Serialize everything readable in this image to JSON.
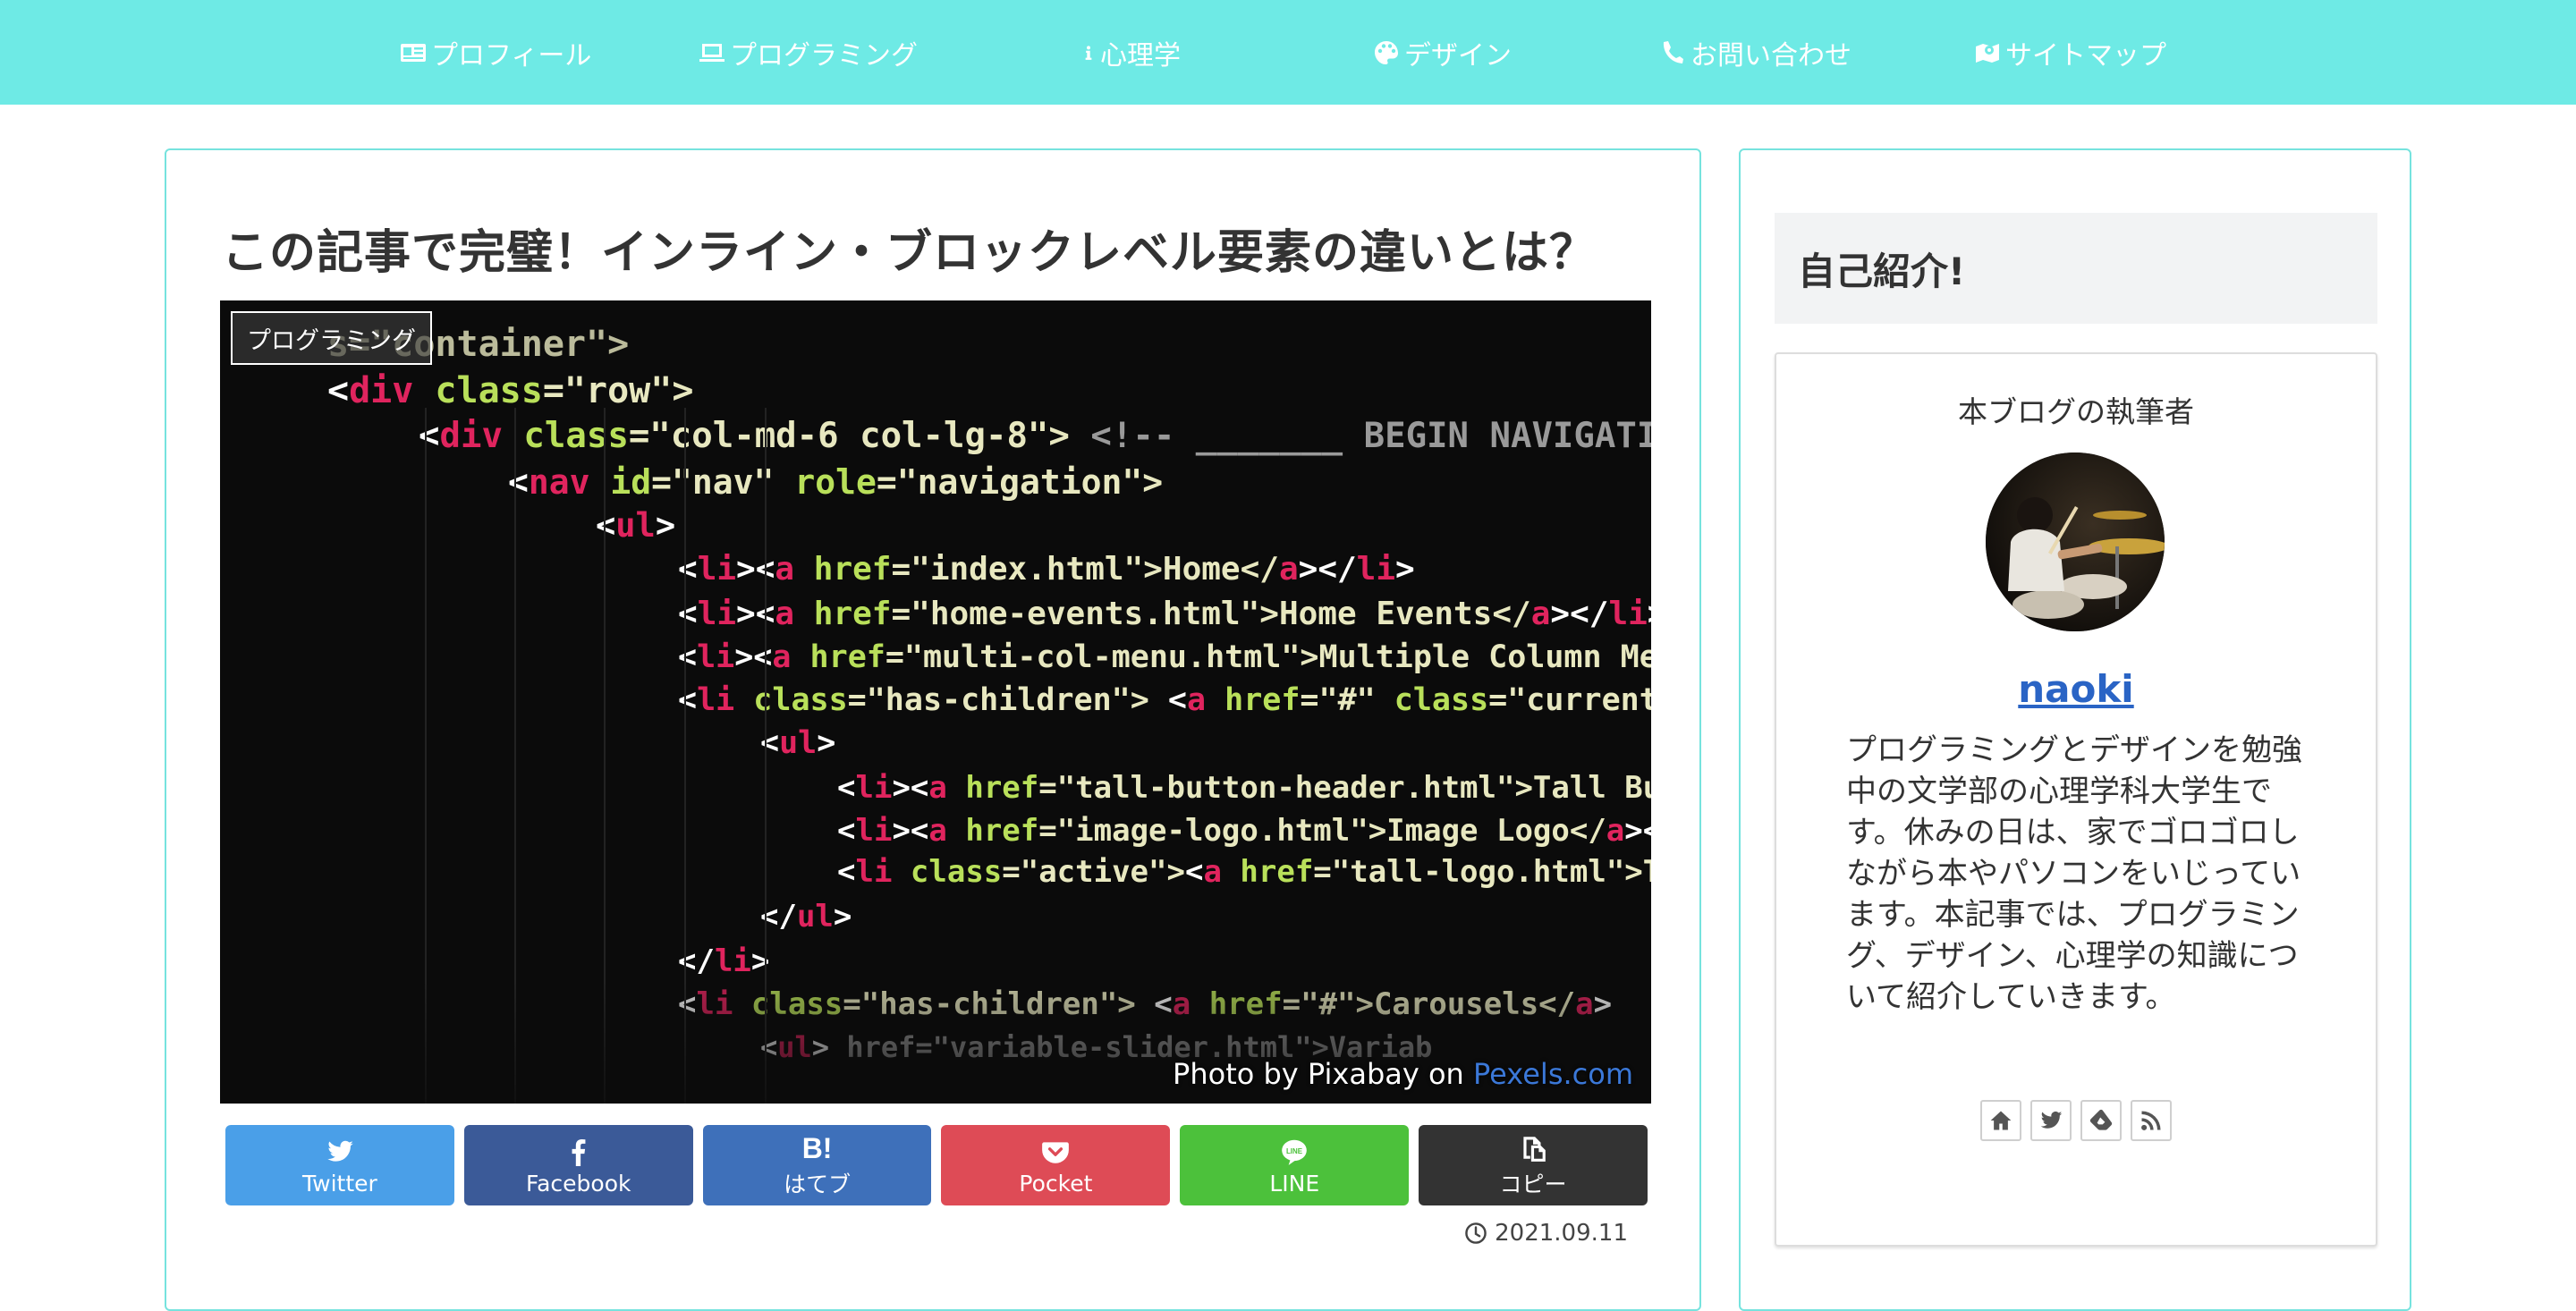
{
  "nav": {
    "items": [
      {
        "label": "プロフィール",
        "icon": "id-card-icon"
      },
      {
        "label": "プログラミング",
        "icon": "laptop-icon"
      },
      {
        "label": "心理学",
        "icon": "info-icon"
      },
      {
        "label": "デザイン",
        "icon": "palette-icon"
      },
      {
        "label": "お問い合わせ",
        "icon": "phone-icon"
      },
      {
        "label": "サイトマップ",
        "icon": "map-icon"
      }
    ]
  },
  "article": {
    "title": "この記事で完璧！インライン・ブロックレベル要素の違いとは？",
    "category": "プログラミング",
    "credit_prefix": "Photo by Pixabay on ",
    "credit_link": "Pexels.com",
    "date": "2021.09.11"
  },
  "share": {
    "twitter": "Twitter",
    "facebook": "Facebook",
    "hatena": "はてブ",
    "hatena_mark": "B!",
    "pocket": "Pocket",
    "line": "LINE",
    "copy": "コピー"
  },
  "colors": {
    "nav_bg": "#6eeae5",
    "card_border": "#76e3de",
    "twitter": "#4a9fe8",
    "facebook": "#3b5a98",
    "hatena": "#3e70ba",
    "pocket": "#de4b56",
    "line": "#4cc13b",
    "copy": "#333333",
    "author_link": "#2a64c5"
  },
  "sidebar": {
    "widget_title": "自己紹介!",
    "profile_heading": "本ブログの執筆者",
    "author_name": "naoki",
    "description": "プログラミングとデザインを勉強中の文学部の心理学科大学生です。休みの日は、家でゴロゴロしながら本やパソコンをいじっています。本記事では、プログラミング、デザイン、心理学の知識について紹介していきます。",
    "icons": [
      "home-icon",
      "twitter-icon",
      "feedly-icon",
      "rss-icon"
    ]
  },
  "code_image": {
    "lines": [
      [
        [
          "s=",
          "#e8e8c0"
        ],
        [
          "\"container\">",
          "#e8e8c0"
        ]
      ],
      [
        [
          "<",
          "#fff"
        ],
        [
          "div ",
          "#e0245e"
        ],
        [
          "class",
          "#b9e05a"
        ],
        [
          "=\"row\">",
          "#e8e8c0"
        ]
      ],
      [
        [
          "<",
          "#fff"
        ],
        [
          "div ",
          "#e0245e"
        ],
        [
          "class",
          "#b9e05a"
        ],
        [
          "=\"col-md-6 col-lg-8\"> ",
          "#e8e8c0"
        ],
        [
          "<!-- _______ BEGIN NAVIGATION",
          "#9a9a9a"
        ]
      ],
      [
        [
          "<",
          "#fff"
        ],
        [
          "nav ",
          "#e0245e"
        ],
        [
          "id",
          "#b9e05a"
        ],
        [
          "=\"nav\" ",
          "#e8e8c0"
        ],
        [
          "role",
          "#b9e05a"
        ],
        [
          "=\"navigation\">",
          "#e8e8c0"
        ]
      ],
      [
        [
          "<",
          "#fff"
        ],
        [
          "ul",
          "#e0245e"
        ],
        [
          ">",
          "#fff"
        ]
      ],
      [
        [
          "<",
          "#fff"
        ],
        [
          "li",
          "#e0245e"
        ],
        [
          "><",
          "#fff"
        ],
        [
          "a ",
          "#e0245e"
        ],
        [
          "href",
          "#b9e05a"
        ],
        [
          "=\"index.html\">Home</",
          "#e8e8c0"
        ],
        [
          "a",
          "#e0245e"
        ],
        [
          "></",
          "#fff"
        ],
        [
          "li",
          "#e0245e"
        ],
        [
          ">",
          "#fff"
        ]
      ],
      [
        [
          "<",
          "#fff"
        ],
        [
          "li",
          "#e0245e"
        ],
        [
          "><",
          "#fff"
        ],
        [
          "a ",
          "#e0245e"
        ],
        [
          "href",
          "#b9e05a"
        ],
        [
          "=\"home-events.html\">Home Events</",
          "#e8e8c0"
        ],
        [
          "a",
          "#e0245e"
        ],
        [
          "></",
          "#fff"
        ],
        [
          "li",
          "#e0245e"
        ],
        [
          ">",
          "#fff"
        ]
      ],
      [
        [
          "<",
          "#fff"
        ],
        [
          "li",
          "#e0245e"
        ],
        [
          "><",
          "#fff"
        ],
        [
          "a ",
          "#e0245e"
        ],
        [
          "href",
          "#b9e05a"
        ],
        [
          "=\"multi-col-menu.html\">Multiple Column Menu",
          "#e8e8c0"
        ]
      ],
      [
        [
          "<",
          "#fff"
        ],
        [
          "li ",
          "#e0245e"
        ],
        [
          "class",
          "#b9e05a"
        ],
        [
          "=\"has-children\"> ",
          "#e8e8c0"
        ],
        [
          "<",
          "#fff"
        ],
        [
          "a ",
          "#e0245e"
        ],
        [
          "href",
          "#b9e05a"
        ],
        [
          "=\"#\" ",
          "#e8e8c0"
        ],
        [
          "class",
          "#b9e05a"
        ],
        [
          "=\"current\">",
          "#e8e8c0"
        ]
      ],
      [
        [
          "<",
          "#fff"
        ],
        [
          "ul",
          "#e0245e"
        ],
        [
          ">",
          "#fff"
        ]
      ],
      [
        [
          "<",
          "#fff"
        ],
        [
          "li",
          "#e0245e"
        ],
        [
          "><",
          "#fff"
        ],
        [
          "a ",
          "#e0245e"
        ],
        [
          "href",
          "#b9e05a"
        ],
        [
          "=\"tall-button-header.html\">Tall But",
          "#e8e8c0"
        ]
      ],
      [
        [
          "<",
          "#fff"
        ],
        [
          "li",
          "#e0245e"
        ],
        [
          "><",
          "#fff"
        ],
        [
          "a ",
          "#e0245e"
        ],
        [
          "href",
          "#b9e05a"
        ],
        [
          "=\"image-logo.html\">Image Logo</",
          "#e8e8c0"
        ],
        [
          "a",
          "#e0245e"
        ],
        [
          "></",
          "#fff"
        ]
      ],
      [
        [
          "<",
          "#fff"
        ],
        [
          "li ",
          "#e0245e"
        ],
        [
          "class",
          "#b9e05a"
        ],
        [
          "=\"active\">",
          "#e8e8c0"
        ],
        [
          "<",
          "#fff"
        ],
        [
          "a ",
          "#e0245e"
        ],
        [
          "href",
          "#b9e05a"
        ],
        [
          "=\"tall-logo.html\">Ta",
          "#e8e8c0"
        ]
      ],
      [
        [
          "</",
          "#fff"
        ],
        [
          "ul",
          "#e0245e"
        ],
        [
          ">",
          "#fff"
        ]
      ],
      [
        [
          "</",
          "#fff"
        ],
        [
          "li",
          "#e0245e"
        ],
        [
          ">",
          "#fff"
        ]
      ],
      [
        [
          "<",
          "#fff"
        ],
        [
          "li ",
          "#e0245e"
        ],
        [
          "class",
          "#b9e05a"
        ],
        [
          "=\"has-children\"> ",
          "#e8e8c0"
        ],
        [
          "<",
          "#fff"
        ],
        [
          "a ",
          "#e0245e"
        ],
        [
          "href",
          "#b9e05a"
        ],
        [
          "=\"#\">Carousels</",
          "#e8e8c0"
        ],
        [
          "a",
          "#e0245e"
        ],
        [
          ">",
          "#fff"
        ]
      ],
      [
        [
          "<",
          "#fff"
        ],
        [
          "ul",
          "#e0245e"
        ],
        [
          ">",
          "#fff"
        ],
        [
          "   href=\"variable-slider.html\">Variab",
          "#9a9a9a"
        ]
      ]
    ]
  }
}
